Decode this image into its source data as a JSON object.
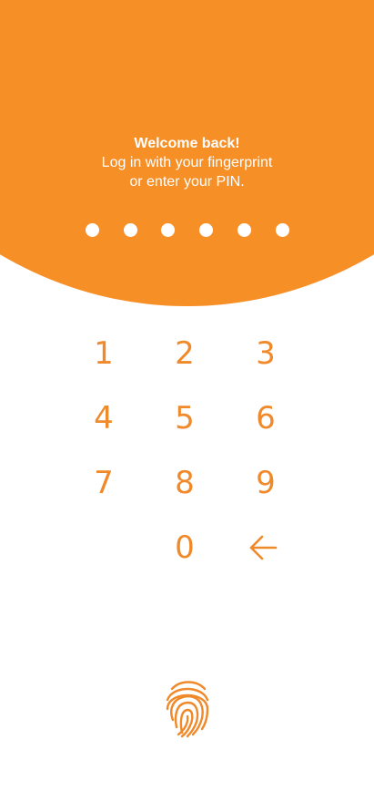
{
  "header": {
    "title": "Welcome back!",
    "line1": "Log in with your fingerprint",
    "line2": "or enter your PIN."
  },
  "pin": {
    "length": 6,
    "filled": 0
  },
  "keypad": {
    "keys": [
      "1",
      "2",
      "3",
      "4",
      "5",
      "6",
      "7",
      "8",
      "9",
      "0"
    ],
    "backspace_icon": "arrow-left-icon"
  },
  "fingerprint": {
    "icon": "fingerprint-icon"
  },
  "colors": {
    "accent": "#f78f27",
    "key_text": "#f0892a",
    "background": "#ffffff",
    "header_text": "#ffffff"
  }
}
